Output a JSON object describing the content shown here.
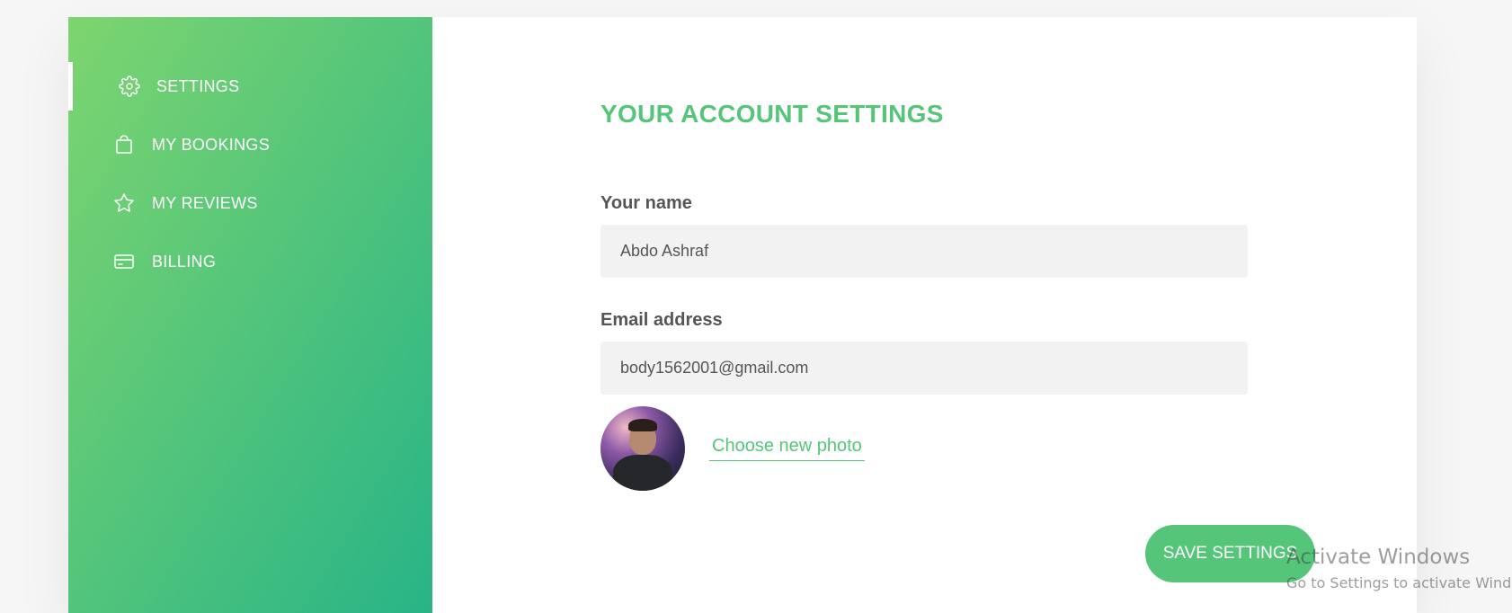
{
  "sidebar": {
    "items": [
      {
        "label": "SETTINGS",
        "icon": "gear-icon",
        "active": true
      },
      {
        "label": "MY BOOKINGS",
        "icon": "shopping-bag-icon",
        "active": false
      },
      {
        "label": "MY REVIEWS",
        "icon": "star-icon",
        "active": false
      },
      {
        "label": "BILLING",
        "icon": "credit-card-icon",
        "active": false
      }
    ]
  },
  "main": {
    "heading": "YOUR ACCOUNT SETTINGS",
    "name_label": "Your name",
    "name_value": "Abdo Ashraf",
    "email_label": "Email address",
    "email_value": "body1562001@gmail.com",
    "photo_link": "Choose new photo",
    "save_button": "SAVE SETTINGS"
  },
  "watermark": {
    "title": "Activate Windows",
    "subtitle": "Go to Settings to activate Windows."
  },
  "colors": {
    "accent": "#55c57a",
    "sidebar_gradient_start": "#7dd56f",
    "sidebar_gradient_end": "#28b487",
    "input_bg": "#f2f2f2"
  }
}
